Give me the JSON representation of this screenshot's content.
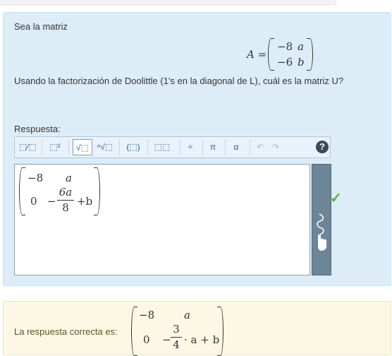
{
  "question": {
    "intro": "Sea la matriz",
    "matrix_label": "A =",
    "matrix": [
      [
        "−8",
        "a"
      ],
      [
        "−6",
        "b"
      ]
    ],
    "prompt": "Usando la factorización de Doolittle (1's en la diagonal de L), cuál es la matriz U?"
  },
  "response": {
    "label": "Respuesta:",
    "toolbar": {
      "buttons": [
        {
          "icon": "fraction-icon",
          "glyph": "⬚⁄⬚"
        },
        {
          "icon": "superscript-icon",
          "glyph": "⬚²"
        },
        {
          "icon": "sqrt-icon",
          "glyph": "√⬚"
        },
        {
          "icon": "nth-root-icon",
          "glyph": "ⁿ√⬚"
        },
        {
          "icon": "parentheses-icon",
          "glyph": "(⬚)"
        },
        {
          "icon": "matrix-icon",
          "glyph": "⬚⬚"
        },
        {
          "icon": "division-icon",
          "glyph": "÷"
        },
        {
          "icon": "pi-icon",
          "glyph": "π"
        },
        {
          "icon": "alpha-icon",
          "glyph": "α"
        },
        {
          "icon": "undo-icon",
          "glyph": "↶"
        },
        {
          "icon": "redo-icon",
          "glyph": "↷"
        }
      ],
      "help": "?"
    },
    "entered": {
      "r1c1": "−8",
      "r1c2": "a",
      "r2c1": "0",
      "r2c2_sign": "−",
      "r2c2_num": "6a",
      "r2c2_den": "8",
      "r2c2_tail": "+b"
    },
    "status_icon": "check-icon",
    "status_color": "#58b33a"
  },
  "correct": {
    "label": "La respuesta correcta es:",
    "r1c1": "−8",
    "r1c2": "a",
    "r2c1": "0",
    "r2c2_sign": "−",
    "r2c2_num": "3",
    "r2c2_den": "4",
    "r2c2_tail": "· a + b"
  }
}
